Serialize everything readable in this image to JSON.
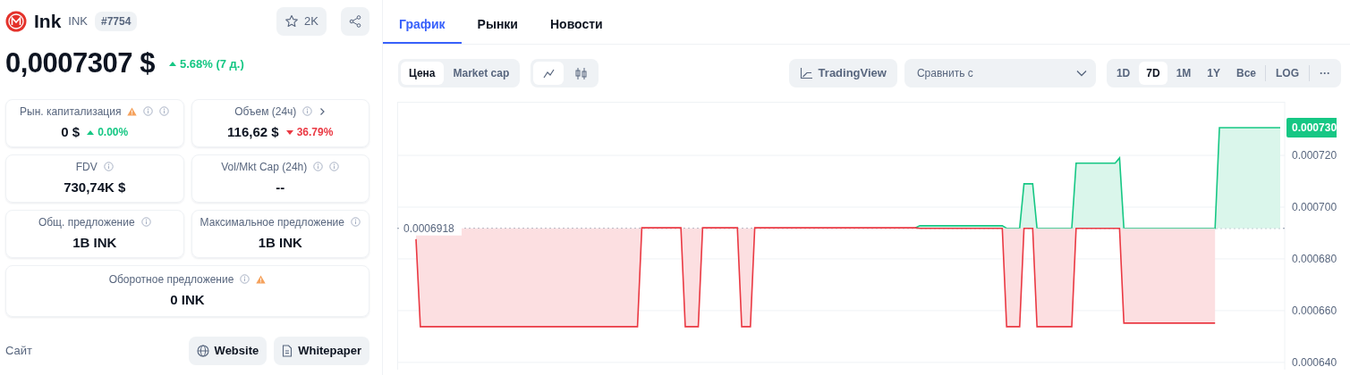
{
  "coin": {
    "name": "Ink",
    "symbol": "INK",
    "rank": "#7754"
  },
  "watch": {
    "count": "2K"
  },
  "price": {
    "value": "0,0007307 $",
    "change": "5.68% (7 д.)",
    "rising": true
  },
  "stats": [
    {
      "label": "Рын. капитализация",
      "icons": [
        {
          "kind": "warning"
        },
        {
          "kind": "info"
        },
        {
          "kind": "info"
        }
      ],
      "value": "0 $",
      "change": "0.00%",
      "rising": true
    },
    {
      "label": "Объем (24ч)",
      "icons": [
        {
          "kind": "info"
        },
        {
          "kind": "chevron"
        }
      ],
      "value": "116,62 $",
      "change": "36.79%",
      "rising": false
    },
    {
      "label": "FDV",
      "icons": [
        {
          "kind": "info"
        }
      ],
      "value": "730,74K $"
    },
    {
      "label": "Vol/Mkt Cap (24h)",
      "icons": [
        {
          "kind": "info"
        },
        {
          "kind": "info"
        }
      ],
      "value": "--"
    },
    {
      "label": "Общ. предложение",
      "icons": [
        {
          "kind": "info"
        }
      ],
      "value": "1B INK"
    },
    {
      "label": "Максимальное предложение",
      "icons": [
        {
          "kind": "info"
        }
      ],
      "value": "1B INK"
    },
    {
      "label": "Оборотное предложение",
      "icons": [
        {
          "kind": "info"
        },
        {
          "kind": "warning"
        }
      ],
      "value": "0 INK"
    }
  ],
  "links": {
    "label": "Сайт",
    "buttons": [
      {
        "kind": "globe",
        "label": "Website"
      },
      {
        "kind": "document",
        "label": "Whitepaper"
      }
    ]
  },
  "tabs": [
    {
      "label": "График",
      "selected": true
    },
    {
      "label": "Рынки",
      "selected": false
    },
    {
      "label": "Новости",
      "selected": false
    }
  ],
  "price_mode": [
    {
      "label": "Цена",
      "selected": true
    },
    {
      "label": "Market cap",
      "selected": false
    }
  ],
  "chart_style": [
    {
      "kind": "line",
      "selected": true
    },
    {
      "kind": "candles",
      "selected": false
    }
  ],
  "tradingview": {
    "label": "TradingView"
  },
  "compare": {
    "placeholder": "Сравнить с"
  },
  "ranges": [
    {
      "label": "1D",
      "selected": false
    },
    {
      "label": "7D",
      "selected": true
    },
    {
      "label": "1M",
      "selected": false
    },
    {
      "label": "1Y",
      "selected": false
    },
    {
      "label": "Все",
      "selected": false
    }
  ],
  "log": {
    "label": "LOG"
  },
  "more": {
    "label": "···"
  },
  "chart": {
    "chart_data": {
      "type": "line",
      "ylim": [
        0.0006372,
        0.0007407
      ],
      "grid": true,
      "yticks": [
        {
          "value": 0.00064,
          "label": "0.000640"
        },
        {
          "value": 0.00066,
          "label": "0.000660"
        },
        {
          "value": 0.00068,
          "label": "0.000680"
        },
        {
          "value": 0.0007,
          "label": "0.000700"
        },
        {
          "value": 0.00072,
          "label": "0.000720"
        }
      ],
      "categories": [
        null,
        null,
        null,
        null,
        null,
        null,
        null,
        null,
        null,
        null,
        null,
        null,
        null,
        null,
        null,
        null,
        null,
        null,
        null,
        null,
        null,
        null,
        null,
        null,
        null,
        null,
        null,
        null,
        null,
        null,
        null,
        null,
        null,
        null,
        null,
        null,
        null,
        null,
        null,
        null,
        null,
        null,
        null,
        null,
        null,
        null,
        null,
        null,
        null,
        null,
        null,
        null,
        null,
        null,
        null,
        null,
        null,
        null,
        null,
        null,
        null,
        null,
        null,
        null,
        null,
        null,
        null,
        null,
        null,
        null,
        null,
        null,
        null,
        null,
        null,
        null,
        null,
        null,
        null,
        null,
        null,
        null,
        null,
        null,
        null,
        null,
        null,
        null,
        null,
        null,
        null,
        null,
        null,
        null,
        null,
        null,
        null,
        null,
        null,
        null,
        null,
        null,
        null,
        null,
        null,
        null,
        null,
        null,
        null,
        null,
        null,
        null,
        null,
        null,
        null,
        null,
        null,
        null,
        null,
        null,
        null,
        null,
        null,
        null,
        null,
        null,
        null,
        null,
        null,
        null,
        null,
        null,
        null,
        null,
        null,
        null,
        null,
        null,
        null,
        null,
        null,
        null,
        null,
        null,
        null,
        null,
        null,
        null,
        null,
        null,
        null,
        null,
        null,
        null,
        null,
        null,
        null,
        null,
        null,
        null,
        null,
        null,
        null,
        null,
        null,
        null,
        null,
        null,
        null,
        null,
        null,
        null,
        null,
        null,
        null,
        null,
        null,
        null,
        null,
        null,
        null,
        null,
        null,
        null,
        null,
        null,
        null,
        null,
        null,
        null,
        null,
        null,
        null,
        null,
        null,
        null,
        null,
        null,
        null,
        null
      ],
      "series": [
        {
          "color": "#16c784",
          "values": [
            null,
            null,
            null,
            null,
            null,
            null,
            null,
            null,
            null,
            null,
            null,
            null,
            null,
            null,
            null,
            null,
            null,
            null,
            null,
            null,
            null,
            null,
            null,
            null,
            null,
            null,
            null,
            null,
            null,
            null,
            null,
            null,
            null,
            null,
            null,
            null,
            null,
            null,
            null,
            null,
            null,
            null,
            null,
            null,
            null,
            null,
            null,
            null,
            null,
            null,
            null,
            null,
            null,
            null,
            null,
            null,
            null,
            null,
            null,
            null,
            null,
            null,
            null,
            null,
            null,
            null,
            null,
            null,
            null,
            null,
            null,
            null,
            null,
            null,
            null,
            null,
            null,
            null,
            null,
            null,
            null,
            null,
            null,
            null,
            null,
            null,
            null,
            null,
            null,
            null,
            null,
            null,
            null,
            null,
            null,
            null,
            null,
            null,
            null,
            null,
            null,
            null,
            null,
            null,
            null,
            null,
            null,
            null,
            null,
            null,
            null,
            null,
            null,
            null,
            null,
            0.000692,
            0.0006928,
            0.0006928,
            0.0006928,
            0.0006928,
            0.0006928,
            0.0006928,
            0.0006928,
            0.0006928,
            0.0006928,
            0.0006928,
            0.0006928,
            0.0006928,
            0.0006928,
            0.0006928,
            0.0006928,
            0.0006928,
            0.0006928,
            0.0006928,
            0.0006928,
            0.0006928,
            0.0006918,
            0.0006918,
            0.0006918,
            0.0006918,
            0.000709,
            0.000709,
            0.000709,
            0.0006918,
            0.0006918,
            0.0006918,
            0.0006918,
            0.0006918,
            0.0006918,
            0.0006918,
            0.0006918,
            0.0006918,
            0.000717,
            0.000717,
            0.000717,
            0.000717,
            0.000717,
            0.000717,
            0.000717,
            0.000717,
            0.000717,
            0.000717,
            0.000719,
            0.0006918,
            0.0006918,
            0.0006918,
            0.0006918,
            0.0006918,
            0.0006918,
            0.0006918,
            0.0006918,
            0.0006918,
            0.0006918,
            0.0006918,
            0.0006918,
            0.0006918,
            0.0006918,
            0.0006918,
            0.0006918,
            0.0006918,
            0.0006918,
            0.0006918,
            0.0006918,
            0.0006918,
            0.0006918,
            0.0007307,
            0.0007307,
            0.0007307,
            0.0007307,
            0.0007307,
            0.0007307,
            0.0007307,
            0.0007307,
            0.0007307,
            0.0007307,
            0.0007307,
            0.0007307,
            0.0007307,
            0.0007307,
            0.0007307
          ]
        },
        {
          "color": "#ea3943",
          "values": [
            0.0006876,
            0.0006538,
            0.0006538,
            0.0006538,
            0.0006538,
            0.0006538,
            0.0006538,
            0.0006538,
            0.0006538,
            0.0006538,
            0.0006538,
            0.0006538,
            0.0006538,
            0.0006538,
            0.0006538,
            0.0006538,
            0.0006538,
            0.0006538,
            0.0006538,
            0.0006538,
            0.0006538,
            0.0006538,
            0.0006538,
            0.0006538,
            0.0006538,
            0.0006538,
            0.0006538,
            0.0006538,
            0.0006538,
            0.0006538,
            0.0006538,
            0.0006538,
            0.0006538,
            0.0006538,
            0.0006538,
            0.0006538,
            0.0006538,
            0.0006538,
            0.0006538,
            0.0006538,
            0.0006538,
            0.0006538,
            0.0006538,
            0.0006538,
            0.0006538,
            0.0006538,
            0.0006538,
            0.0006538,
            0.0006538,
            0.0006538,
            0.0006538,
            0.0006538,
            0.000692,
            0.000692,
            0.000692,
            0.000692,
            0.000692,
            0.000692,
            0.000692,
            0.000692,
            0.000692,
            0.000692,
            0.0006538,
            0.0006538,
            0.0006538,
            0.0006538,
            0.000692,
            0.000692,
            0.000692,
            0.000692,
            0.000692,
            0.000692,
            0.000692,
            0.000692,
            0.000692,
            0.0006538,
            0.0006538,
            0.0006538,
            0.000692,
            0.000692,
            0.000692,
            0.000692,
            0.000692,
            0.000692,
            0.000692,
            0.000692,
            0.000692,
            0.000692,
            0.000692,
            0.000692,
            0.000692,
            0.000692,
            0.000692,
            0.000692,
            0.000692,
            0.000692,
            0.000692,
            0.000692,
            0.000692,
            0.000692,
            0.000692,
            0.000692,
            0.000692,
            0.000692,
            0.000692,
            0.000692,
            0.000692,
            0.000692,
            0.000692,
            0.000692,
            0.000692,
            0.000692,
            0.000692,
            0.000692,
            0.000692,
            0.000692,
            0.0006918,
            0.0006918,
            0.0006918,
            0.0006918,
            0.0006918,
            0.0006918,
            0.0006918,
            0.0006918,
            0.0006918,
            0.0006918,
            0.0006918,
            0.0006918,
            0.0006918,
            0.0006918,
            0.0006918,
            0.0006918,
            0.0006918,
            0.0006918,
            0.0006918,
            0.0006918,
            0.0006538,
            0.0006538,
            0.0006538,
            0.0006538,
            0.0006918,
            0.0006918,
            0.0006918,
            0.0006538,
            0.0006538,
            0.0006538,
            0.0006538,
            0.0006538,
            0.0006538,
            0.0006538,
            0.0006538,
            0.0006538,
            0.0006918,
            0.0006918,
            0.0006918,
            0.0006918,
            0.0006918,
            0.0006918,
            0.0006918,
            0.0006918,
            0.0006918,
            0.0006918,
            0.0006918,
            0.0006552,
            0.0006552,
            0.0006552,
            0.0006552,
            0.0006552,
            0.0006552,
            0.0006552,
            0.0006552,
            0.0006552,
            0.0006552,
            0.0006552,
            0.0006552,
            0.0006552,
            0.0006552,
            0.0006552,
            0.0006552,
            0.0006552,
            0.0006552,
            0.0006552,
            0.0006552,
            0.0006552,
            0.0006552,
            null,
            null,
            null,
            null,
            null,
            null,
            null,
            null,
            null,
            null,
            null,
            null,
            null,
            null,
            null
          ]
        }
      ],
      "ref_lines": [
        {
          "axis": "y",
          "value": 0.0006918,
          "label": "0.0006918"
        }
      ],
      "annotations": [
        {
          "text": "0.000730"
        }
      ]
    }
  }
}
